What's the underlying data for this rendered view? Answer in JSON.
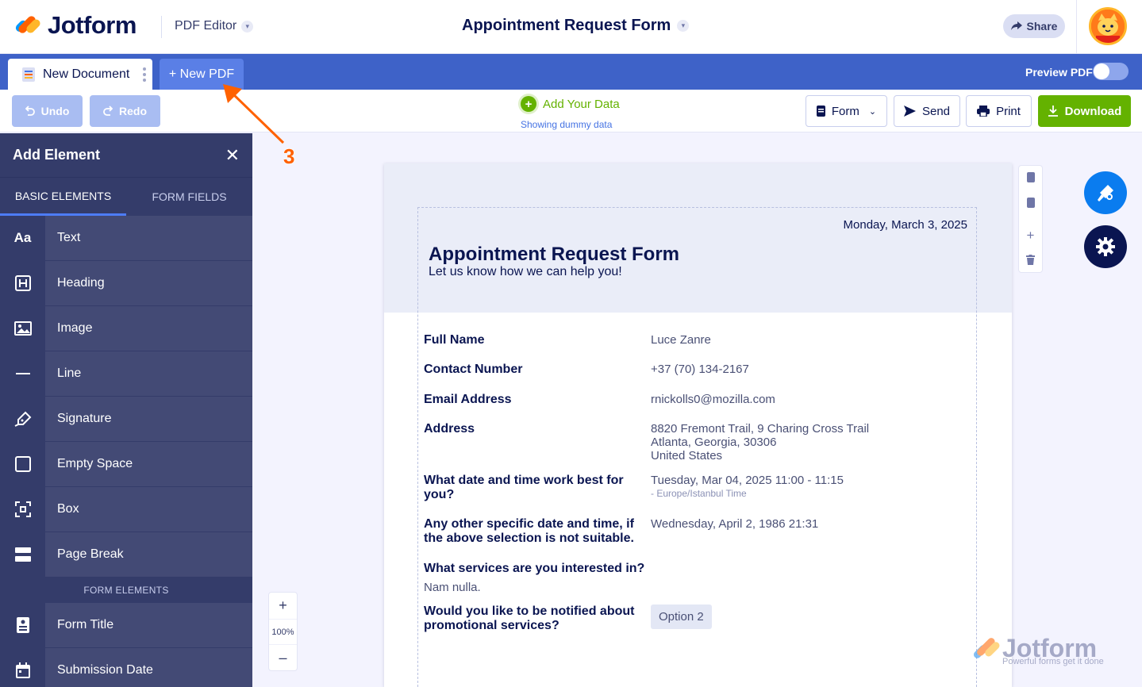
{
  "header": {
    "brand": "Jotform",
    "product": "PDF Editor",
    "document_title": "Appointment Request Form",
    "share_label": "Share"
  },
  "tabs": {
    "document_tab": "New Document",
    "new_pdf": "+ New PDF",
    "preview_label": "Preview PDF"
  },
  "toolbar": {
    "undo": "Undo",
    "redo": "Redo",
    "add_data": "Add Your Data",
    "dummy_note": "Showing dummy data",
    "form": "Form",
    "send": "Send",
    "print": "Print",
    "download": "Download"
  },
  "sidebar": {
    "title": "Add Element",
    "tabs": [
      "BASIC ELEMENTS",
      "FORM FIELDS"
    ],
    "items": [
      {
        "icon": "Aa",
        "label": "Text"
      },
      {
        "icon": "H",
        "label": "Heading"
      },
      {
        "icon": "image-icon",
        "label": "Image"
      },
      {
        "icon": "line-icon",
        "label": "Line"
      },
      {
        "icon": "signature-icon",
        "label": "Signature"
      },
      {
        "icon": "empty-space-icon",
        "label": "Empty Space"
      },
      {
        "icon": "box-icon",
        "label": "Box"
      },
      {
        "icon": "page-break-icon",
        "label": "Page Break"
      }
    ],
    "section_label": "FORM ELEMENTS",
    "form_items": [
      {
        "icon": "form-title-icon",
        "label": "Form Title"
      },
      {
        "icon": "calendar-icon",
        "label": "Submission Date"
      }
    ]
  },
  "zoom": {
    "plus": "+",
    "value": "100%",
    "minus": "–"
  },
  "page": {
    "date": "Monday, March 3, 2025",
    "title": "Appointment Request Form",
    "subtitle": "Let us know how we can help you!",
    "fields": [
      {
        "q": "Full Name",
        "a": "Luce Zanre"
      },
      {
        "q": "Contact Number",
        "a": "+37 (70) 134-2167"
      },
      {
        "q": "Email Address",
        "a": "rnickolls0@mozilla.com"
      },
      {
        "q": "Address",
        "a_lines": [
          "8820 Fremont Trail, 9 Charing Cross Trail",
          "Atlanta, Georgia, 30306",
          "United States"
        ]
      },
      {
        "q": "What date and time work best for you?",
        "a": "Tuesday, Mar 04, 2025 11:00 - 11:15",
        "tz": "- Europe/Istanbul Time"
      },
      {
        "q": "Any other specific date and time, if the above selection is not suitable.",
        "a": "Wednesday, April 2, 1986 21:31"
      },
      {
        "q": "What services are you interested in?",
        "a": "Nam nulla."
      },
      {
        "q": "Would you like to be notified about promotional services?",
        "a": "Option 2"
      }
    ]
  },
  "watermark": {
    "brand": "Jotform",
    "tagline": "Powerful forms get it done"
  },
  "annotation": {
    "number": "3"
  },
  "colors": {
    "accent_blue": "#3e62c8",
    "new_pdf_tab": "#5a7fe6",
    "green": "#64b200",
    "navy": "#0a1551",
    "sidebar": "#434a75",
    "annotation": "#ff6100"
  }
}
